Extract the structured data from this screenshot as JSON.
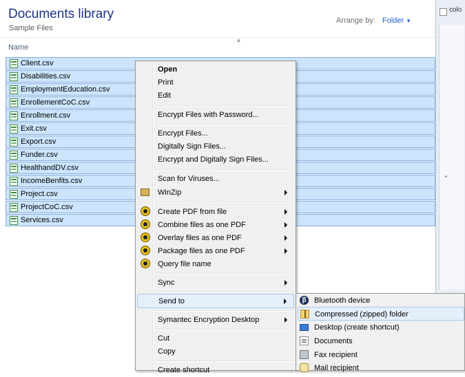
{
  "library": {
    "title": "Documents library",
    "subtitle": "Sample Files",
    "arrange_label": "Arrange by:",
    "arrange_value": "Folder"
  },
  "right_pane": {
    "partial_text": "colo"
  },
  "columns": {
    "name": "Name"
  },
  "files": [
    {
      "name": "Client.csv"
    },
    {
      "name": "Disabilities.csv"
    },
    {
      "name": "EmploymentEducation.csv"
    },
    {
      "name": "EnrollementCoC.csv"
    },
    {
      "name": "Enrollment.csv"
    },
    {
      "name": "Exit.csv"
    },
    {
      "name": "Export.csv"
    },
    {
      "name": "Funder.csv"
    },
    {
      "name": "HealthandDV.csv"
    },
    {
      "name": "IncomeBenfits.csv"
    },
    {
      "name": "Project.csv"
    },
    {
      "name": "ProjectCoC.csv"
    },
    {
      "name": "Services.csv"
    }
  ],
  "context_menu": {
    "open": "Open",
    "print": "Print",
    "edit": "Edit",
    "encrypt_password": "Encrypt Files with Password...",
    "encrypt_files": "Encrypt Files...",
    "digitally_sign": "Digitally Sign Files...",
    "encrypt_sign": "Encrypt and Digitally Sign Files...",
    "scan": "Scan for Viruses...",
    "winzip": "WinZip",
    "create_pdf": "Create PDF from file",
    "combine_pdf": "Combine files as one PDF",
    "overlay_pdf": "Overlay files as one PDF",
    "package_pdf": "Package files as one PDF",
    "query_name": "Query file name",
    "sync": "Sync",
    "send_to": "Send to",
    "symantec": "Symantec Encryption Desktop",
    "cut": "Cut",
    "copy": "Copy",
    "create_shortcut": "Create shortcut"
  },
  "send_to_menu": {
    "bluetooth": "Bluetooth device",
    "compressed": "Compressed (zipped) folder",
    "desktop": "Desktop (create shortcut)",
    "documents": "Documents",
    "fax": "Fax recipient",
    "mail": "Mail recipient"
  },
  "colors": {
    "title": "#1e3287",
    "selection_fill": "#cce5fd",
    "selection_border": "#84acdd",
    "menu_bg": "#f0f0f0",
    "accent": "#1e5fd0"
  }
}
